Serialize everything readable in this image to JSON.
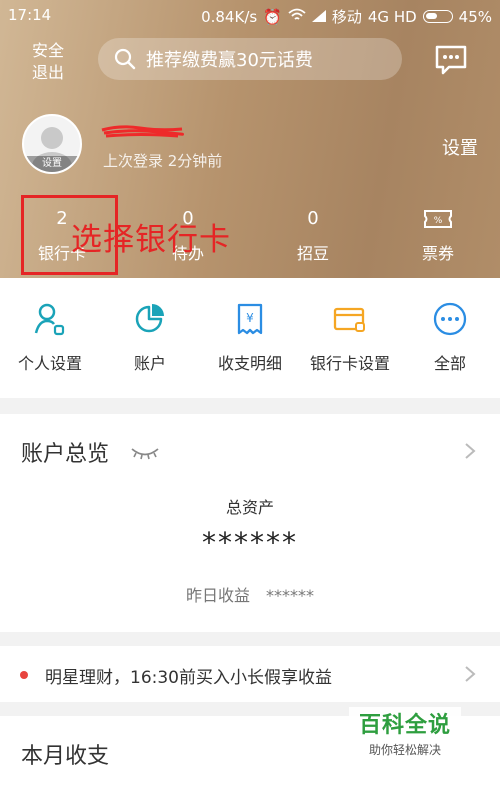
{
  "status_bar": {
    "time": "17:14",
    "network_speed": "0.84K/s",
    "carrier": "移动",
    "network_type": "4G HD",
    "battery": "45%"
  },
  "header": {
    "logout_label": "安全\n退出",
    "search_placeholder": "推荐缴费赢30元话费",
    "avatar_tag": "设置",
    "last_login": "上次登录 2分钟前",
    "settings_label": "设置"
  },
  "stats": [
    {
      "value": "2",
      "label": "银行卡"
    },
    {
      "value": "0",
      "label": "待办"
    },
    {
      "value": "0",
      "label": "招豆"
    },
    {
      "value": "",
      "label": "票券",
      "icon": "ticket-icon"
    }
  ],
  "annotation": {
    "text": "选择银行卡",
    "color": "#e52525"
  },
  "quick_actions": [
    {
      "label": "个人设置",
      "icon": "person-settings-icon"
    },
    {
      "label": "账户",
      "icon": "pie-chart-icon"
    },
    {
      "label": "收支明细",
      "icon": "receipt-icon"
    },
    {
      "label": "银行卡设置",
      "icon": "card-settings-icon"
    },
    {
      "label": "全部",
      "icon": "more-icon"
    }
  ],
  "overview": {
    "title": "账户总览",
    "total_assets_label": "总资产",
    "total_assets_value": "******",
    "yesterday_label": "昨日收益",
    "yesterday_value": "******"
  },
  "promo": {
    "text": "明星理财，16:30前买入小长假享收益"
  },
  "monthly": {
    "title": "本月收支"
  },
  "watermark": {
    "title": "百科全说",
    "subtitle": "助你轻松解决"
  },
  "colors": {
    "accent": "#1aa3b8",
    "orange": "#f5a623",
    "blue": "#2b8de3",
    "red": "#e52525",
    "header": "#b6936d"
  }
}
